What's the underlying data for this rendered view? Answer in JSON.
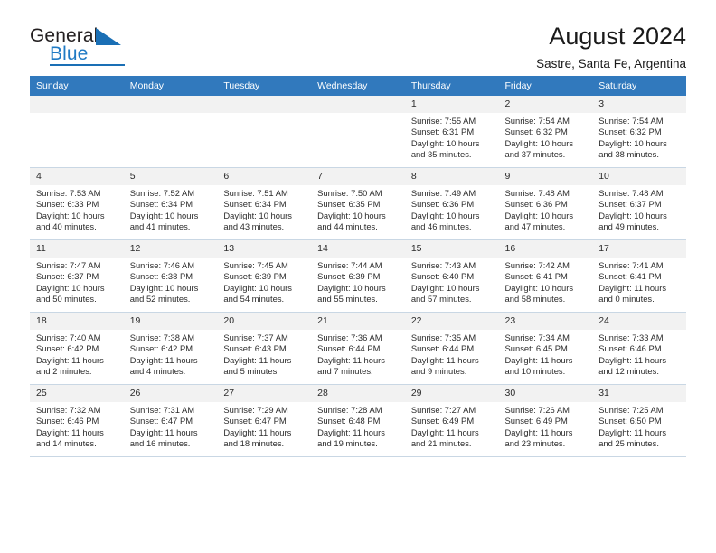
{
  "brand": {
    "name_part1": "General",
    "name_part2": "Blue",
    "accent_color": "#1a6fb5"
  },
  "header": {
    "title": "August 2024",
    "subtitle": "Sastre, Santa Fe, Argentina"
  },
  "calendar": {
    "header_bg": "#3179bd",
    "daynum_bg": "#f2f2f2",
    "grid_line_color": "#c9d7e4",
    "weekday_headers": [
      "Sunday",
      "Monday",
      "Tuesday",
      "Wednesday",
      "Thursday",
      "Friday",
      "Saturday"
    ],
    "weeks": [
      [
        {
          "day": "",
          "lines": []
        },
        {
          "day": "",
          "lines": []
        },
        {
          "day": "",
          "lines": []
        },
        {
          "day": "",
          "lines": []
        },
        {
          "day": "1",
          "lines": [
            "Sunrise: 7:55 AM",
            "Sunset: 6:31 PM",
            "Daylight: 10 hours",
            "and 35 minutes."
          ]
        },
        {
          "day": "2",
          "lines": [
            "Sunrise: 7:54 AM",
            "Sunset: 6:32 PM",
            "Daylight: 10 hours",
            "and 37 minutes."
          ]
        },
        {
          "day": "3",
          "lines": [
            "Sunrise: 7:54 AM",
            "Sunset: 6:32 PM",
            "Daylight: 10 hours",
            "and 38 minutes."
          ]
        }
      ],
      [
        {
          "day": "4",
          "lines": [
            "Sunrise: 7:53 AM",
            "Sunset: 6:33 PM",
            "Daylight: 10 hours",
            "and 40 minutes."
          ]
        },
        {
          "day": "5",
          "lines": [
            "Sunrise: 7:52 AM",
            "Sunset: 6:34 PM",
            "Daylight: 10 hours",
            "and 41 minutes."
          ]
        },
        {
          "day": "6",
          "lines": [
            "Sunrise: 7:51 AM",
            "Sunset: 6:34 PM",
            "Daylight: 10 hours",
            "and 43 minutes."
          ]
        },
        {
          "day": "7",
          "lines": [
            "Sunrise: 7:50 AM",
            "Sunset: 6:35 PM",
            "Daylight: 10 hours",
            "and 44 minutes."
          ]
        },
        {
          "day": "8",
          "lines": [
            "Sunrise: 7:49 AM",
            "Sunset: 6:36 PM",
            "Daylight: 10 hours",
            "and 46 minutes."
          ]
        },
        {
          "day": "9",
          "lines": [
            "Sunrise: 7:48 AM",
            "Sunset: 6:36 PM",
            "Daylight: 10 hours",
            "and 47 minutes."
          ]
        },
        {
          "day": "10",
          "lines": [
            "Sunrise: 7:48 AM",
            "Sunset: 6:37 PM",
            "Daylight: 10 hours",
            "and 49 minutes."
          ]
        }
      ],
      [
        {
          "day": "11",
          "lines": [
            "Sunrise: 7:47 AM",
            "Sunset: 6:37 PM",
            "Daylight: 10 hours",
            "and 50 minutes."
          ]
        },
        {
          "day": "12",
          "lines": [
            "Sunrise: 7:46 AM",
            "Sunset: 6:38 PM",
            "Daylight: 10 hours",
            "and 52 minutes."
          ]
        },
        {
          "day": "13",
          "lines": [
            "Sunrise: 7:45 AM",
            "Sunset: 6:39 PM",
            "Daylight: 10 hours",
            "and 54 minutes."
          ]
        },
        {
          "day": "14",
          "lines": [
            "Sunrise: 7:44 AM",
            "Sunset: 6:39 PM",
            "Daylight: 10 hours",
            "and 55 minutes."
          ]
        },
        {
          "day": "15",
          "lines": [
            "Sunrise: 7:43 AM",
            "Sunset: 6:40 PM",
            "Daylight: 10 hours",
            "and 57 minutes."
          ]
        },
        {
          "day": "16",
          "lines": [
            "Sunrise: 7:42 AM",
            "Sunset: 6:41 PM",
            "Daylight: 10 hours",
            "and 58 minutes."
          ]
        },
        {
          "day": "17",
          "lines": [
            "Sunrise: 7:41 AM",
            "Sunset: 6:41 PM",
            "Daylight: 11 hours",
            "and 0 minutes."
          ]
        }
      ],
      [
        {
          "day": "18",
          "lines": [
            "Sunrise: 7:40 AM",
            "Sunset: 6:42 PM",
            "Daylight: 11 hours",
            "and 2 minutes."
          ]
        },
        {
          "day": "19",
          "lines": [
            "Sunrise: 7:38 AM",
            "Sunset: 6:42 PM",
            "Daylight: 11 hours",
            "and 4 minutes."
          ]
        },
        {
          "day": "20",
          "lines": [
            "Sunrise: 7:37 AM",
            "Sunset: 6:43 PM",
            "Daylight: 11 hours",
            "and 5 minutes."
          ]
        },
        {
          "day": "21",
          "lines": [
            "Sunrise: 7:36 AM",
            "Sunset: 6:44 PM",
            "Daylight: 11 hours",
            "and 7 minutes."
          ]
        },
        {
          "day": "22",
          "lines": [
            "Sunrise: 7:35 AM",
            "Sunset: 6:44 PM",
            "Daylight: 11 hours",
            "and 9 minutes."
          ]
        },
        {
          "day": "23",
          "lines": [
            "Sunrise: 7:34 AM",
            "Sunset: 6:45 PM",
            "Daylight: 11 hours",
            "and 10 minutes."
          ]
        },
        {
          "day": "24",
          "lines": [
            "Sunrise: 7:33 AM",
            "Sunset: 6:46 PM",
            "Daylight: 11 hours",
            "and 12 minutes."
          ]
        }
      ],
      [
        {
          "day": "25",
          "lines": [
            "Sunrise: 7:32 AM",
            "Sunset: 6:46 PM",
            "Daylight: 11 hours",
            "and 14 minutes."
          ]
        },
        {
          "day": "26",
          "lines": [
            "Sunrise: 7:31 AM",
            "Sunset: 6:47 PM",
            "Daylight: 11 hours",
            "and 16 minutes."
          ]
        },
        {
          "day": "27",
          "lines": [
            "Sunrise: 7:29 AM",
            "Sunset: 6:47 PM",
            "Daylight: 11 hours",
            "and 18 minutes."
          ]
        },
        {
          "day": "28",
          "lines": [
            "Sunrise: 7:28 AM",
            "Sunset: 6:48 PM",
            "Daylight: 11 hours",
            "and 19 minutes."
          ]
        },
        {
          "day": "29",
          "lines": [
            "Sunrise: 7:27 AM",
            "Sunset: 6:49 PM",
            "Daylight: 11 hours",
            "and 21 minutes."
          ]
        },
        {
          "day": "30",
          "lines": [
            "Sunrise: 7:26 AM",
            "Sunset: 6:49 PM",
            "Daylight: 11 hours",
            "and 23 minutes."
          ]
        },
        {
          "day": "31",
          "lines": [
            "Sunrise: 7:25 AM",
            "Sunset: 6:50 PM",
            "Daylight: 11 hours",
            "and 25 minutes."
          ]
        }
      ]
    ]
  }
}
